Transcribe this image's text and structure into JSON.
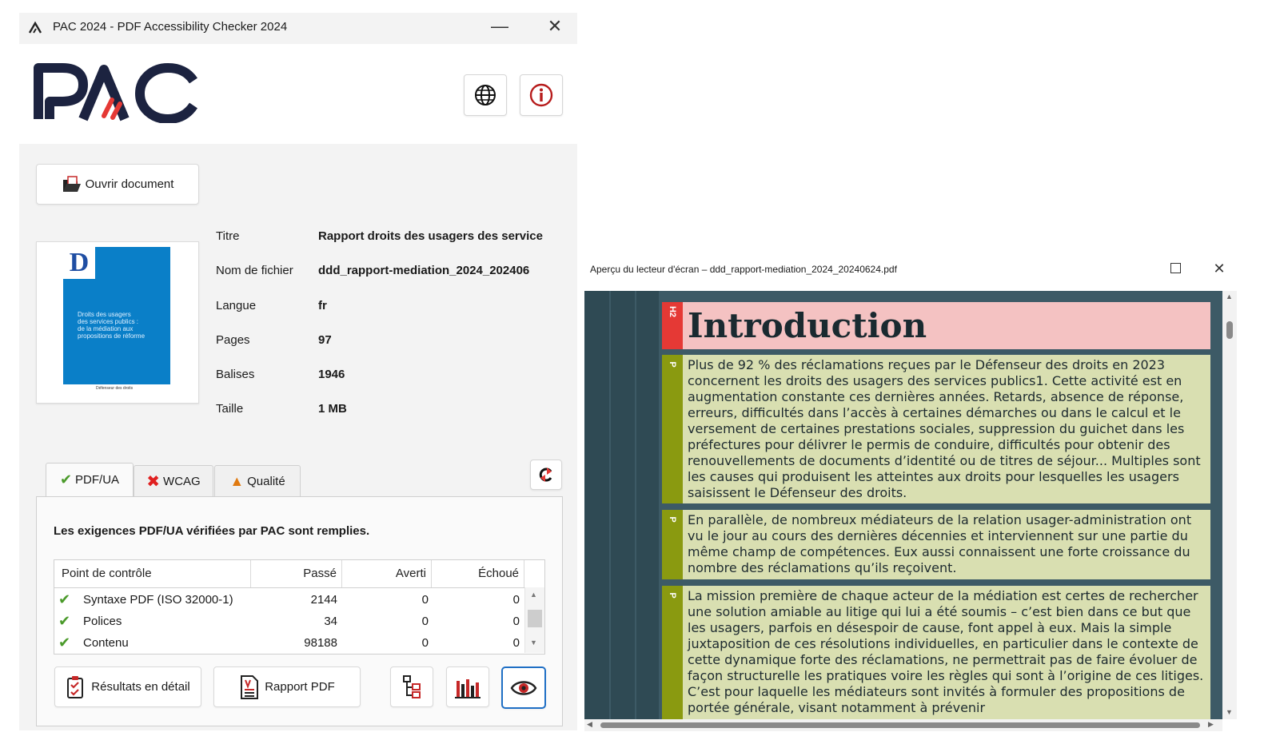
{
  "main_window": {
    "title": "PAC 2024 - PDF Accessibility Checker 2024",
    "logo_text": "PAC",
    "open_button_label": "Ouvrir document",
    "cover": {
      "letter": "D",
      "lines": [
        "Droits des usagers",
        "des services publics :",
        "de la médiation aux",
        "propositions de réforme"
      ],
      "footer": "Défenseur des droits"
    },
    "metadata": [
      {
        "label": "Titre",
        "value": "Rapport droits des usagers des service"
      },
      {
        "label": "Nom de fichier",
        "value": "ddd_rapport-mediation_2024_202406"
      },
      {
        "label": "Langue",
        "value": "fr"
      },
      {
        "label": "Pages",
        "value": "97"
      },
      {
        "label": "Balises",
        "value": "1946"
      },
      {
        "label": "Taille",
        "value": "1 MB"
      }
    ],
    "tabs": [
      {
        "label": "PDF/UA",
        "icon": "check-icon",
        "color": "#4a9a2a"
      },
      {
        "label": "WCAG",
        "icon": "x-icon",
        "color": "#e02020"
      },
      {
        "label": "Qualité",
        "icon": "warning-icon",
        "color": "#e07a10"
      }
    ],
    "status_message": "Les exigences PDF/UA vérifiées par PAC sont remplies.",
    "table": {
      "headers": [
        "Point de contrôle",
        "Passé",
        "Averti",
        "Échoué"
      ],
      "rows": [
        {
          "name": "Syntaxe PDF (ISO 32000-1)",
          "passed": "2144",
          "warned": "0",
          "failed": "0"
        },
        {
          "name": "Polices",
          "passed": "34",
          "warned": "0",
          "failed": "0"
        },
        {
          "name": "Contenu",
          "passed": "98188",
          "warned": "0",
          "failed": "0"
        }
      ]
    },
    "buttons": {
      "details": "Résultats en détail",
      "report": "Rapport PDF"
    }
  },
  "preview_window": {
    "title": "Aperçu du lecteur d'écran – ddd_rapport-mediation_2024_20240624.pdf",
    "heading_tag": "H2",
    "paragraph_tag": "P",
    "heading": "Introduction",
    "paragraphs": [
      "Plus de 92 % des réclamations reçues par le Défenseur des droits en 2023 concernent les droits des usagers des services publics1. Cette activité est en augmentation constante ces dernières années. Retards, absence de réponse, erreurs, difficultés dans l’accès à certaines démarches ou dans le calcul et le versement de certaines prestations sociales, suppression du guichet dans les préfectures pour délivrer le permis de conduire, difficultés pour obtenir des renouvellements de documents d’identité ou de titres de séjour... Multiples sont les causes qui produisent les atteintes aux droits pour lesquelles les usagers saisissent le Défenseur des droits.",
      "En parallèle, de nombreux médiateurs de la relation usager-administration ont vu le jour au cours des dernières décennies et interviennent sur une partie du même champ de compétences. Eux aussi connaissent une forte croissance du nombre des réclamations qu’ils reçoivent.",
      "La mission première de chaque acteur de la médiation est certes de rechercher une solution amiable au litige qui lui a été soumis – c’est bien dans ce but que les usagers, parfois en désespoir de cause, font appel à eux. Mais la simple juxtaposition de ces résolutions individuelles, en particulier dans le contexte de cette dynamique forte des réclamations, ne permettrait pas de faire évoluer de façon structurelle les pratiques voire les règles qui sont à l’origine de ces litiges. C’est pour laquelle les médiateurs sont invités à formuler des propositions de portée générale, visant notamment à prévenir"
    ],
    "colors": {
      "heading_bg": "#f4c2c2",
      "heading_tag": "#e53935",
      "paragraph_bg": "#d9dfb1",
      "paragraph_tag": "#8a9a10",
      "canvas": "#3d5a66"
    }
  }
}
